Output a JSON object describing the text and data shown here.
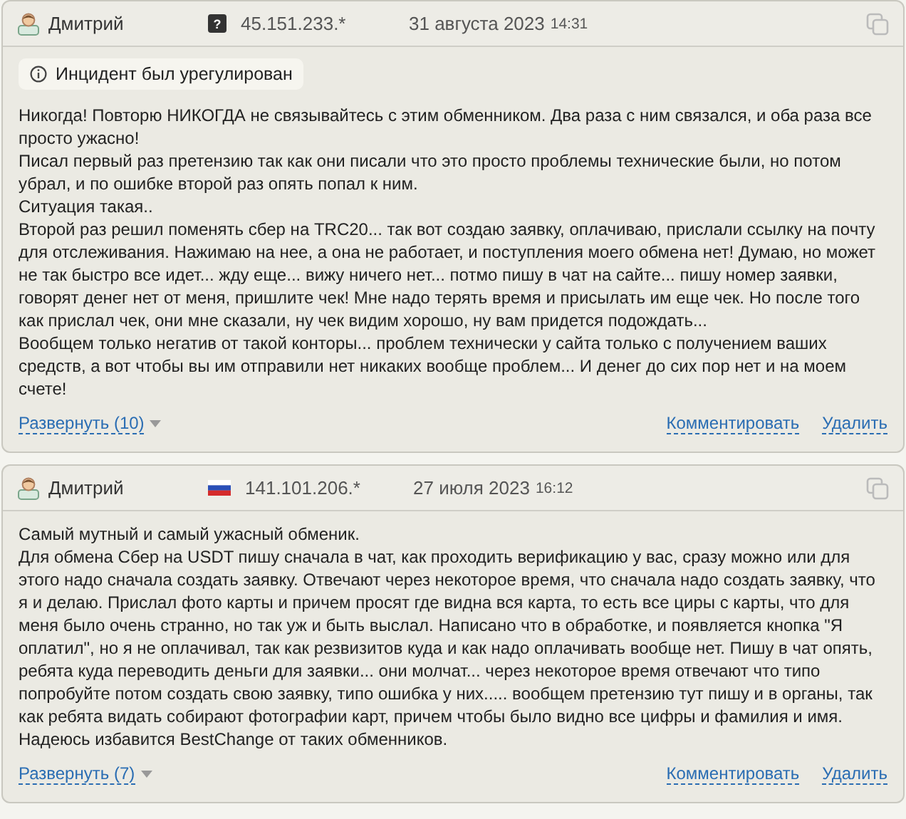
{
  "reviews": [
    {
      "author": "Дмитрий",
      "flag": {
        "kind": "unknown",
        "label": "?"
      },
      "ip": "45.151.233.*",
      "date": "31 августа 2023",
      "time": "14:31",
      "notice": "Инцидент был урегулирован",
      "paragraphs": [
        "Никогда! Повторю НИКОГДА не связывайтесь с этим обменником. Два раза с ним связался, и оба раза все просто ужасно!",
        "Писал первый раз претензию так как они писали что это просто проблемы технические были, но потом убрал, и по ошибке второй раз опять попал к ним.",
        "Ситуация такая..",
        "Второй раз решил поменять сбер на TRC20... так вот создаю заявку, оплачиваю, прислали ссылку на почту для отслеживания. Нажимаю на нее, а она не работает, и поступления моего обмена нет! Думаю, но может не так быстро все идет... жду еще... вижу ничего нет... потмо пишу в чат на сайте... пишу номер заявки, говорят денег нет от меня, пришлите чек! Мне надо терять время и присылать им еще чек. Но после того как прислал чек, они мне сказали, ну чек видим хорошо, ну вам придется подождать...",
        "Вообщем только негатив от такой конторы... проблем технически у сайта только с получением ваших средств, а вот чтобы вы им отправили нет никаких вообще проблем... И денег до сих пор нет и на моем счете!"
      ],
      "expand": "Развернуть (10)",
      "comment": "Комментировать",
      "delete": "Удалить"
    },
    {
      "author": "Дмитрий",
      "flag": {
        "kind": "ru"
      },
      "ip": "141.101.206.*",
      "date": "27 июля 2023",
      "time": "16:12",
      "paragraphs": [
        "Самый мутный и самый ужасный обменик.",
        "Для обмена Сбер на USDT пишу сначала в чат, как проходить верификацию у вас, сразу можно или для этого надо сначала создать заявку. Отвечают через некоторое время, что сначала надо создать заявку, что я и делаю. Прислал фото карты и причем просят где видна вся карта, то есть все циры с карты, что для меня было очень странно, но так уж и быть выслал. Написано что в обработке, и появляется кнопка \"Я оплатил\", но я не оплачивал, так как резвизитов куда и как надо оплачивать вообще нет. Пишу в чат опять, ребята куда переводить деньги для заявки... они молчат... через некоторое время отвечают что типо попробуйте потом создать свою заявку, типо ошибка у них..... вообщем претензию тут пишу и в органы, так как ребята видать собирают фотографии карт, причем чтобы было видно все цифры и фамилия и имя.",
        "Надеюсь избавится BestChange от таких обменников."
      ],
      "expand": "Развернуть (7)",
      "comment": "Комментировать",
      "delete": "Удалить"
    }
  ]
}
